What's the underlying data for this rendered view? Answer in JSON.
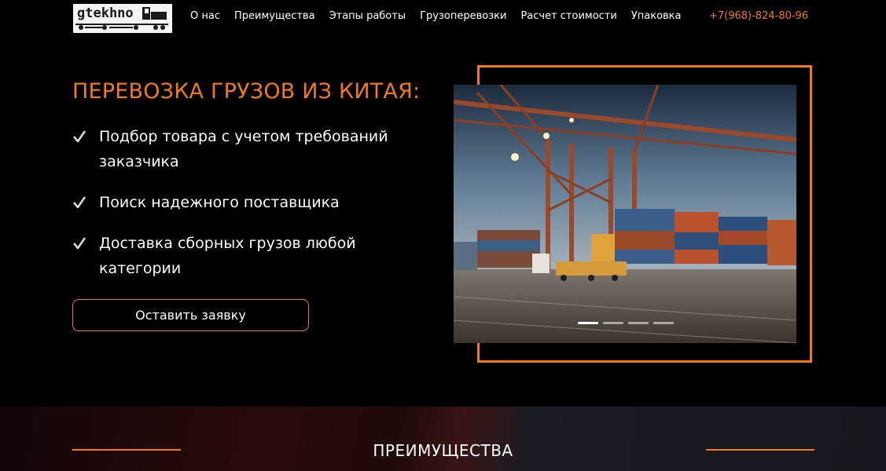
{
  "header": {
    "logo_text": "gtekhno",
    "nav": [
      {
        "label": "О нас"
      },
      {
        "label": "Преимущества"
      },
      {
        "label": "Этапы работы"
      },
      {
        "label": "Грузоперевозки"
      },
      {
        "label": "Расчет стоимости"
      },
      {
        "label": "Упаковка"
      }
    ],
    "phone": "+7(968)-824-80-96"
  },
  "hero": {
    "title": "ПЕРЕВОЗКА ГРУЗОВ ИЗ КИТАЯ:",
    "features": [
      {
        "text": "Подбор товара с учетом требований заказчика"
      },
      {
        "text": "Поиск надежного поставщика"
      },
      {
        "text": "Доставка сборных грузов любой категории"
      }
    ],
    "cta_label": "Оставить заявку",
    "slider": {
      "slide_count": 4,
      "active_index": 0
    }
  },
  "section2": {
    "title": "ПРЕИМУЩЕСТВА"
  },
  "colors": {
    "accent": "#f07a16",
    "background": "#000000",
    "text": "#ffffff"
  },
  "icons": {
    "feature_bullet": "checkmark-icon",
    "logo": "truck-logo-icon"
  }
}
